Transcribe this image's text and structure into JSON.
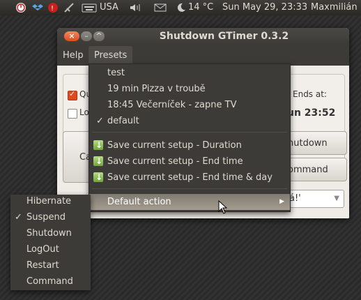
{
  "panel": {
    "keyboard_layout": "USA",
    "temperature": "14 °C",
    "clock": "Sun May 29, 23:33",
    "user": "Maxmilián"
  },
  "window": {
    "title": "Shutdown GTimer 0.3.2",
    "menu": {
      "help": "Help",
      "presets": "Presets"
    }
  },
  "content": {
    "check1_label": "Qu",
    "check1_checked": true,
    "check2_label": "Lo",
    "check2_checked": false,
    "ends_at_label": "Ends at:",
    "ends_at_value": "un 23:52",
    "cancel_label": "Ca",
    "shutdown_label": "hutdown",
    "command_label": "ommand",
    "message_value": "á!'"
  },
  "presets_menu": {
    "items": [
      {
        "label": "test"
      },
      {
        "label": "19 min Pizza v troubě"
      },
      {
        "label": "18:45 Večerníček - zapne TV"
      },
      {
        "label": "default",
        "checked": true
      }
    ],
    "save_items": [
      {
        "label": "Save current setup - Duration",
        "icon": "save-preset-icon"
      },
      {
        "label": "Save current setup - End time",
        "icon": "save-preset-icon"
      },
      {
        "label": "Save current setup - End time & day",
        "icon": "save-preset-icon"
      }
    ],
    "default_action": "Default action"
  },
  "default_action_menu": {
    "items": [
      {
        "label": "Hibernate"
      },
      {
        "label": "Suspend",
        "checked": true
      },
      {
        "label": "Shutdown"
      },
      {
        "label": "LogOut"
      },
      {
        "label": "Restart"
      },
      {
        "label": "Command"
      }
    ]
  },
  "colors": {
    "panel": "#3c3b37",
    "highlight": "#a49c8f",
    "accent": "#e2491a"
  }
}
